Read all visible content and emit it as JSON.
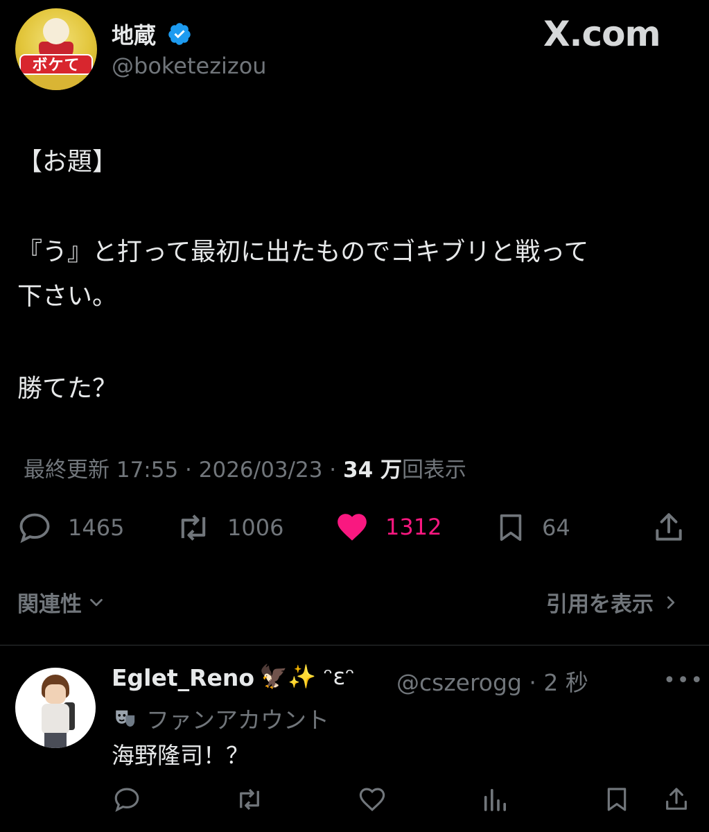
{
  "author": {
    "display_name": "地蔵",
    "handle": "@boketezizou",
    "avatar_badge": "ボケて"
  },
  "brand": {
    "label": "X.com"
  },
  "tweet": {
    "lines": [
      "【お題】",
      "『う』と打って最初に出たものでゴキブリと戦って",
      "下さい。",
      "勝てた？"
    ],
    "meta": {
      "prefix": "最終更新 17:55 · 2026/03/23 · ",
      "views_count": "34",
      "views_unit": "万",
      "views_suffix": "回表示"
    }
  },
  "actions": {
    "replies": "1465",
    "retweets": "1006",
    "likes": "1312",
    "bookmarks": "64"
  },
  "links": {
    "related": "関連性",
    "quotes": "引用を表示"
  },
  "reply": {
    "name": "Eglet_Reno",
    "deco": "🦅✨ ᵔεᵔ",
    "handle": "@cszerogg · 2 秒",
    "badge_label": "ファンアカウント",
    "text": "海野隆司！？"
  },
  "colors": {
    "background": "#000000",
    "text": "#e7e9ea",
    "muted": "#71767b",
    "like": "#f91880",
    "verified": "#1d9bf0"
  }
}
